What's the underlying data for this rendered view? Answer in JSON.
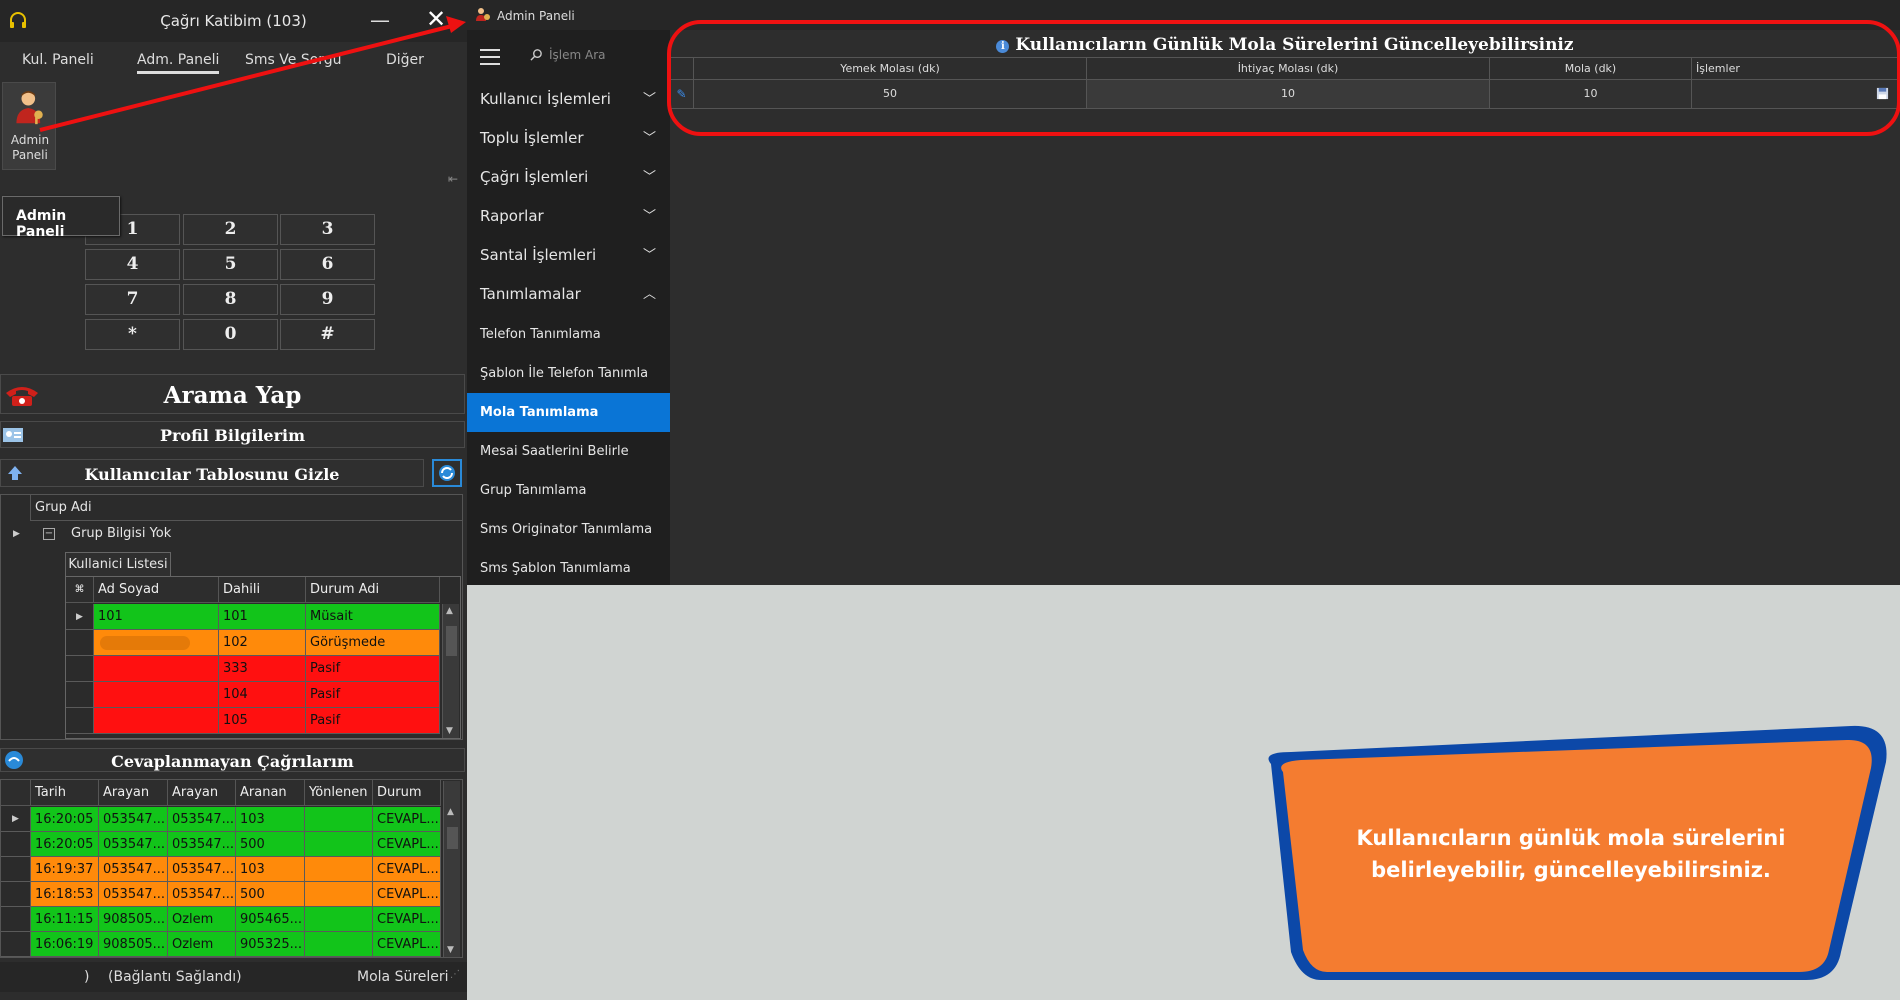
{
  "left_window": {
    "title": "Çağrı Katibim (103)",
    "minimize": "—",
    "close": "✕",
    "tabs": [
      "Kul. Paneli",
      "Adm. Paneli",
      "Sms Ve Sorgu",
      "Diğer"
    ],
    "admin_tile_label": "Admin Paneli",
    "tooltip": "Admin Paneli",
    "keypad": [
      "1",
      "2",
      "3",
      "4",
      "5",
      "6",
      "7",
      "8",
      "9",
      "*",
      "0",
      "#"
    ],
    "call_button": "Arama Yap",
    "profile_section": "Profil Bilgilerim",
    "users_section": "Kullanıcılar Tablosunu Gizle",
    "group_header": "Grup Adi",
    "group_row": "Grup Bilgisi Yok",
    "user_list_tab": "Kullanici Listesi",
    "user_columns": [
      "Ad Soyad",
      "Dahili",
      "Durum Adi"
    ],
    "users": [
      {
        "name": "101",
        "ext": "101",
        "status": "Müsait",
        "color": "green"
      },
      {
        "name": "",
        "ext": "102",
        "status": "Görüşmede",
        "color": "orange"
      },
      {
        "name": "",
        "ext": "333",
        "status": "Pasif",
        "color": "red"
      },
      {
        "name": "",
        "ext": "104",
        "status": "Pasif",
        "color": "red"
      },
      {
        "name": "",
        "ext": "105",
        "status": "Pasif",
        "color": "red"
      }
    ],
    "missed_section": "Cevaplanmayan Çağrılarım",
    "missed_columns": [
      "Tarih",
      "Arayan",
      "Arayan",
      "Aranan",
      "Yönlenen",
      "Durum"
    ],
    "missed_calls": [
      {
        "time": "16:20:05",
        "caller1": "053547...",
        "caller2": "053547...",
        "called": "103",
        "routed": "",
        "status": "CEVAPL...",
        "color": "green"
      },
      {
        "time": "16:20:05",
        "caller1": "053547...",
        "caller2": "053547...",
        "called": "500",
        "routed": "",
        "status": "CEVAPL...",
        "color": "green"
      },
      {
        "time": "16:19:37",
        "caller1": "053547...",
        "caller2": "053547...",
        "called": "103",
        "routed": "",
        "status": "CEVAPL...",
        "color": "orange"
      },
      {
        "time": "16:18:53",
        "caller1": "053547...",
        "caller2": "053547...",
        "called": "500",
        "routed": "",
        "status": "CEVAPL...",
        "color": "orange"
      },
      {
        "time": "16:11:15",
        "caller1": "908505...",
        "caller2": "Ozlem",
        "called": "905465...",
        "routed": "",
        "status": "CEVAPL...",
        "color": "green"
      },
      {
        "time": "16:06:19",
        "caller1": "908505...",
        "caller2": "Ozlem",
        "called": "905325...",
        "routed": "",
        "status": "CEVAPL...",
        "color": "green"
      }
    ],
    "status_bar": {
      "left": ")",
      "connection": "(Bağlantı Sağlandı)",
      "right": "Mola Süreleri"
    }
  },
  "admin_window": {
    "title": "Admin Paneli",
    "search_placeholder": "İşlem Ara",
    "nav": [
      {
        "label": "Kullanıcı İşlemleri",
        "chevron": "﹀"
      },
      {
        "label": "Toplu İşlemler",
        "chevron": "﹀"
      },
      {
        "label": "Çağrı İşlemleri",
        "chevron": "﹀"
      },
      {
        "label": "Raporlar",
        "chevron": "﹀"
      },
      {
        "label": "Santal İşlemleri",
        "chevron": "﹀"
      },
      {
        "label": "Tanımlamalar",
        "chevron": "︿"
      }
    ],
    "sub_nav": [
      "Telefon Tanımlama",
      "Şablon İle Telefon Tanımla",
      "Mola Tanımlama",
      "Mesai Saatlerini Belirle",
      "Grup Tanımlama",
      "Sms Originator Tanımlama",
      "Sms Şablon Tanımlama"
    ],
    "active_sub": "Mola Tanımlama",
    "content_title": "Kullanıcıların Günlük Mola Sürelerini Güncelleyebilirsiniz",
    "columns": [
      "Yemek Molası (dk)",
      "İhtiyaç Molası (dk)",
      "Mola (dk)",
      "İşlemler"
    ],
    "row": {
      "yemek": "50",
      "ihtiyac": "10",
      "mola": "10"
    }
  },
  "callout": {
    "line1": "Kullanıcıların günlük mola sürelerini",
    "line2": "belirleyebilir, güncelleyebilirsiniz."
  },
  "colors": {
    "green": "#12c41a",
    "orange": "#ff8a0a",
    "red": "#ff1010",
    "active_nav": "#0a75d6",
    "annotation": "#e11111",
    "callout_fill": "#f47c30",
    "callout_border": "#0c48a8"
  }
}
